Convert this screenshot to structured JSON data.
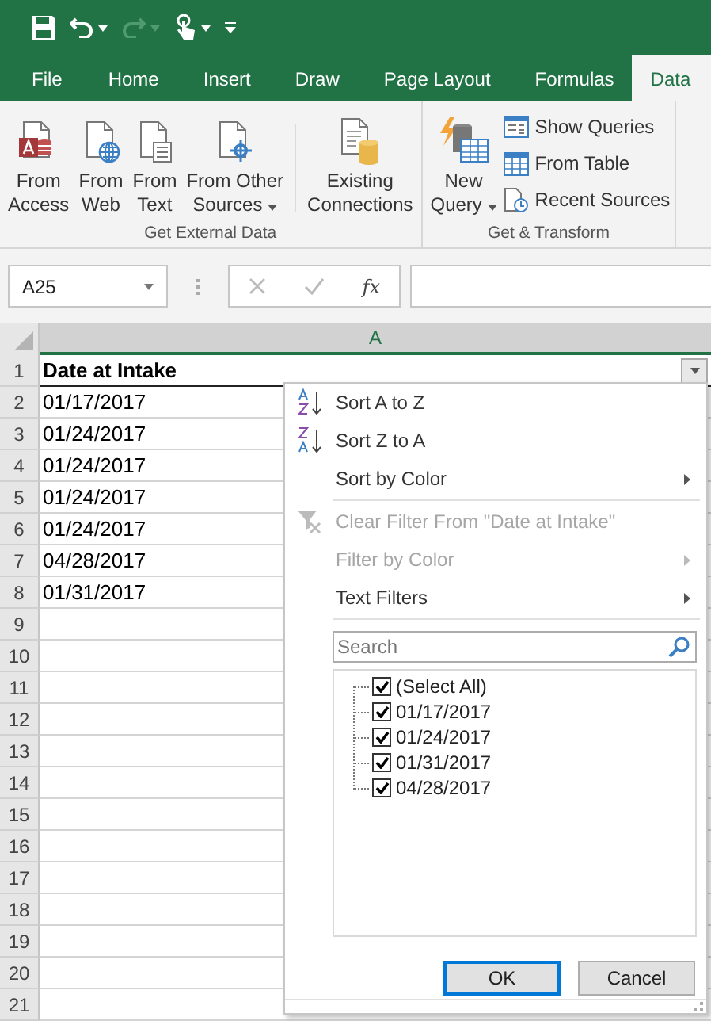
{
  "tabs": [
    {
      "label": "File",
      "selected": false
    },
    {
      "label": "Home",
      "selected": false
    },
    {
      "label": "Insert",
      "selected": false
    },
    {
      "label": "Draw",
      "selected": false
    },
    {
      "label": "Page Layout",
      "selected": false
    },
    {
      "label": "Formulas",
      "selected": false
    },
    {
      "label": "Data",
      "selected": true
    }
  ],
  "ribbon": {
    "groups": [
      {
        "label": "Get External Data",
        "large_buttons": [
          {
            "kind": "access",
            "lines": [
              "From",
              "Access"
            ],
            "has_menu": false
          },
          {
            "kind": "web",
            "lines": [
              "From",
              "Web"
            ],
            "has_menu": false
          },
          {
            "kind": "text",
            "lines": [
              "From",
              "Text"
            ],
            "has_menu": false
          },
          {
            "kind": "other",
            "lines": [
              "From Other",
              "Sources"
            ],
            "has_menu": true
          },
          {
            "kind": "connections",
            "lines": [
              "Existing",
              "Connections"
            ],
            "has_menu": false
          }
        ]
      },
      {
        "label": "Get & Transform",
        "large_buttons": [
          {
            "kind": "query",
            "lines": [
              "New",
              "Query"
            ],
            "has_menu": true
          }
        ],
        "small_buttons": [
          {
            "kind": "queries",
            "label": "Show Queries"
          },
          {
            "kind": "table",
            "label": "From Table"
          },
          {
            "kind": "recent",
            "label": "Recent Sources"
          }
        ]
      }
    ]
  },
  "formula_bar": {
    "name_box": "A25",
    "function_label": "fx"
  },
  "sheet": {
    "column_header": "A",
    "rows": [
      {
        "number": "1",
        "value": "Date at Intake",
        "kind": "header"
      },
      {
        "number": "2",
        "value": "01/17/2017",
        "kind": "data"
      },
      {
        "number": "3",
        "value": "01/24/2017",
        "kind": "data"
      },
      {
        "number": "4",
        "value": "01/24/2017",
        "kind": "data"
      },
      {
        "number": "5",
        "value": "01/24/2017",
        "kind": "data"
      },
      {
        "number": "6",
        "value": "01/24/2017",
        "kind": "data"
      },
      {
        "number": "7",
        "value": "04/28/2017",
        "kind": "data"
      },
      {
        "number": "8",
        "value": "01/31/2017",
        "kind": "data"
      },
      {
        "number": "9",
        "kind": "empty"
      },
      {
        "number": "10",
        "kind": "empty"
      },
      {
        "number": "11",
        "kind": "empty"
      },
      {
        "number": "12",
        "kind": "empty"
      },
      {
        "number": "13",
        "kind": "empty"
      },
      {
        "number": "14",
        "kind": "empty"
      },
      {
        "number": "15",
        "kind": "empty"
      },
      {
        "number": "16",
        "kind": "empty"
      },
      {
        "number": "17",
        "kind": "empty"
      },
      {
        "number": "18",
        "kind": "empty"
      },
      {
        "number": "19",
        "kind": "empty"
      },
      {
        "number": "20",
        "kind": "empty"
      },
      {
        "number": "21",
        "kind": "empty"
      }
    ]
  },
  "filter_menu": {
    "sections": [
      [
        {
          "kind": "sort-ascending",
          "label": "Sort A to Z",
          "disabled": false,
          "submenu": false
        },
        {
          "kind": "sort-descending",
          "label": "Sort Z to A",
          "disabled": false,
          "submenu": false
        },
        {
          "kind": "plain",
          "label": "Sort by Color",
          "disabled": false,
          "submenu": true
        }
      ],
      [
        {
          "kind": "clear-filter",
          "label": "Clear Filter From \"Date at Intake\"",
          "disabled": true,
          "submenu": false
        },
        {
          "kind": "plain",
          "label": "Filter by Color",
          "disabled": true,
          "submenu": true
        },
        {
          "kind": "plain",
          "label": "Text Filters",
          "disabled": false,
          "submenu": true
        }
      ]
    ],
    "search": {
      "placeholder": "Search"
    },
    "values": [
      {
        "label": "(Select All)",
        "checked": true
      },
      {
        "label": "01/17/2017",
        "checked": true
      },
      {
        "label": "01/24/2017",
        "checked": true
      },
      {
        "label": "01/31/2017",
        "checked": true
      },
      {
        "label": "04/28/2017",
        "checked": true
      }
    ],
    "buttons": [
      {
        "label": "OK",
        "default": true
      },
      {
        "label": "Cancel",
        "default": false
      }
    ]
  }
}
